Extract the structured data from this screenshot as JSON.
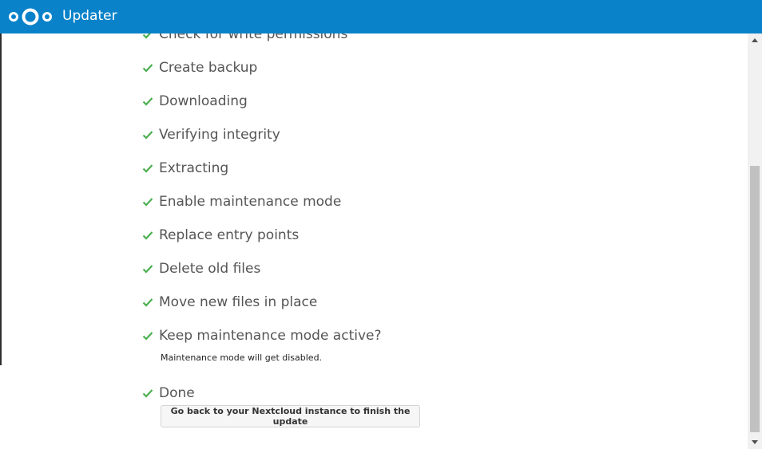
{
  "header": {
    "title": "Updater",
    "logo_icon": "nextcloud-logo-icon",
    "background": "#0a82c9"
  },
  "check_color": "#4caf50",
  "steps": [
    {
      "label": "Check for write permissions",
      "status": "done"
    },
    {
      "label": "Create backup",
      "status": "done"
    },
    {
      "label": "Downloading",
      "status": "done"
    },
    {
      "label": "Verifying integrity",
      "status": "done"
    },
    {
      "label": "Extracting",
      "status": "done"
    },
    {
      "label": "Enable maintenance mode",
      "status": "done"
    },
    {
      "label": "Replace entry points",
      "status": "done"
    },
    {
      "label": "Delete old files",
      "status": "done"
    },
    {
      "label": "Move new files in place",
      "status": "done"
    },
    {
      "label": "Keep maintenance mode active?",
      "status": "done"
    },
    {
      "label": "Done",
      "status": "done"
    }
  ],
  "maintenance_note": "Maintenance mode will get disabled.",
  "finish_button_label": "Go back to your Nextcloud instance to finish the update"
}
